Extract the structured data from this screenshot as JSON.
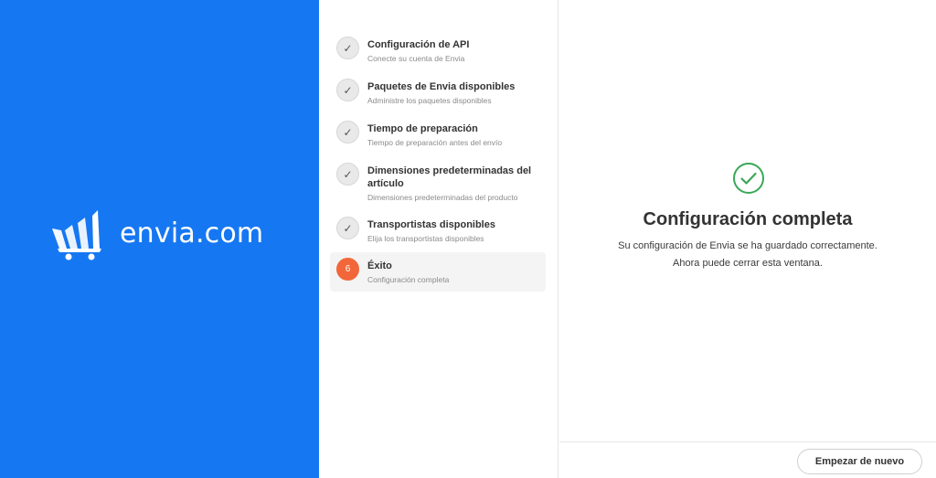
{
  "brand": {
    "name": "envia.com",
    "color": "#1677f2"
  },
  "steps": [
    {
      "title": "Configuración de API",
      "subtitle": "Conecte su cuenta de Envia",
      "status": "done",
      "icon": "check-icon"
    },
    {
      "title": "Paquetes de Envia disponibles",
      "subtitle": "Administre los paquetes disponibles",
      "status": "done",
      "icon": "check-icon"
    },
    {
      "title": "Tiempo de preparación",
      "subtitle": "Tiempo de preparación antes del envío",
      "status": "done",
      "icon": "check-icon"
    },
    {
      "title": "Dimensiones predeterminadas del artículo",
      "subtitle": "Dimensiones predeterminadas del producto",
      "status": "done",
      "icon": "check-icon"
    },
    {
      "title": "Transportistas disponibles",
      "subtitle": "Elija los transportistas disponibles",
      "status": "done",
      "icon": "check-icon"
    },
    {
      "title": "Éxito",
      "subtitle": "Configuración completa",
      "status": "current",
      "number": "6"
    }
  ],
  "content": {
    "icon": "success-check-circle-icon",
    "title": "Configuración completa",
    "message": "Su configuración de Envia se ha guardado correctamente. Ahora puede cerrar esta ventana."
  },
  "footer": {
    "restart_label": "Empezar de nuevo"
  },
  "colors": {
    "accent_success": "#3aa757",
    "current_step": "#f2673a"
  }
}
